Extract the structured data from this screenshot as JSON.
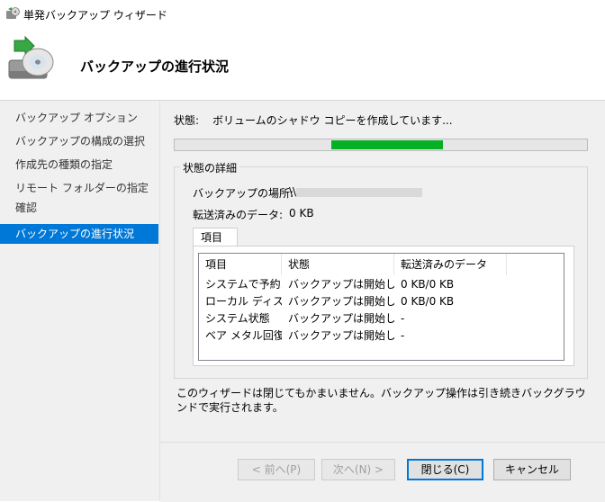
{
  "window": {
    "title": "単発バックアップ ウィザード"
  },
  "header": {
    "title": "バックアップの進行状況"
  },
  "sidebar": {
    "items": [
      {
        "label": "バックアップ オプション"
      },
      {
        "label": "バックアップの構成の選択"
      },
      {
        "label": "作成先の種類の指定"
      },
      {
        "label": "リモート フォルダーの指定"
      },
      {
        "label": "確認"
      },
      {
        "label": "バックアップの進行状況"
      }
    ],
    "active_index": 5
  },
  "status": {
    "label": "状態:",
    "text": "ボリュームのシャドウ コピーを作成しています...",
    "progress_segment_start": 0.38,
    "progress_segment_end": 0.65
  },
  "details": {
    "caption": "状態の詳細",
    "location_label": "バックアップの場所:",
    "location_value": "\\\\",
    "transferred_label": "転送済みのデータ:",
    "transferred_value": "0 KB"
  },
  "tab": {
    "label": "項目"
  },
  "table": {
    "columns": [
      "項目",
      "状態",
      "転送済みのデータ"
    ],
    "rows": [
      [
        "システムで予約...",
        "バックアップは開始して...",
        "0 KB/0 KB"
      ],
      [
        "ローカル ディスク...",
        "バックアップは開始して...",
        "0 KB/0 KB"
      ],
      [
        "システム状態",
        "バックアップは開始して...",
        "-"
      ],
      [
        "ベア メタル回復",
        "バックアップは開始して...",
        "-"
      ]
    ]
  },
  "note": "このウィザードは閉じてもかまいません。バックアップ操作は引き続きバックグラウンドで実行されます。",
  "buttons": {
    "prev": "< 前へ(P)",
    "next": "次へ(N) >",
    "close": "閉じる(C)",
    "cancel": "キャンセル"
  },
  "colors": {
    "accent": "#0078d7",
    "progress": "#06b025"
  }
}
